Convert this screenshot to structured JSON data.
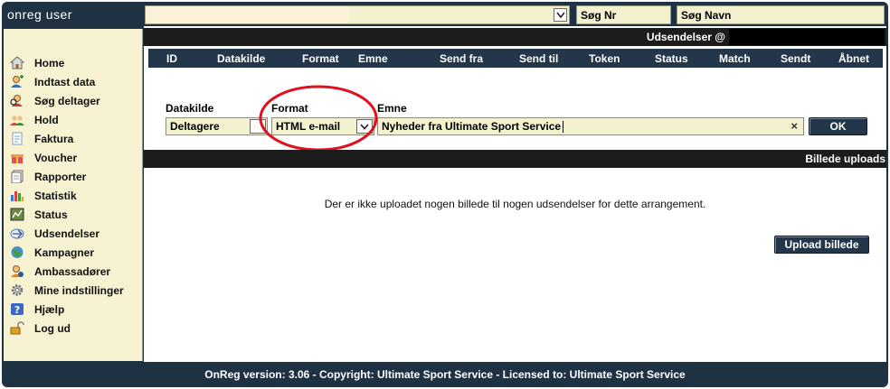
{
  "app": {
    "title": "onreg user"
  },
  "search": {
    "nr_label": "Søg Nr",
    "navn_label": "Søg Navn"
  },
  "nav": {
    "items": [
      {
        "label": "Home",
        "icon": "house-icon"
      },
      {
        "label": "Indtast data",
        "icon": "person-add-icon"
      },
      {
        "label": "Søg deltager",
        "icon": "magnifier-icon"
      },
      {
        "label": "Hold",
        "icon": "group-icon"
      },
      {
        "label": "Faktura",
        "icon": "invoice-icon"
      },
      {
        "label": "Voucher",
        "icon": "gift-icon"
      },
      {
        "label": "Rapporter",
        "icon": "report-icon"
      },
      {
        "label": "Statistik",
        "icon": "bar-chart-icon"
      },
      {
        "label": "Status",
        "icon": "status-icon"
      },
      {
        "label": "Udsendelser",
        "icon": "mail-send-icon"
      },
      {
        "label": "Kampagner",
        "icon": "globe-icon"
      },
      {
        "label": "Ambassadører",
        "icon": "ambassador-icon"
      },
      {
        "label": "Mine indstillinger",
        "icon": "gear-icon"
      },
      {
        "label": "Hjælp",
        "icon": "help-icon"
      },
      {
        "label": "Log ud",
        "icon": "padlock-open-icon"
      }
    ]
  },
  "udsendelser": {
    "title": "Udsendelser @",
    "columns": [
      "ID",
      "Datakilde",
      "Format",
      "Emne",
      "Send fra",
      "Send til",
      "Token",
      "Status",
      "Match",
      "Sendt",
      "Åbnet"
    ]
  },
  "form": {
    "datakilde_label": "Datakilde",
    "datakilde_value": "Deltagere",
    "format_label": "Format",
    "format_value": "HTML e-mail",
    "emne_label": "Emne",
    "emne_value": "Nyheder fra Ultimate Sport Service",
    "clear_glyph": "×",
    "ok_label": "OK"
  },
  "billede": {
    "title": "Billede uploads",
    "empty_message": "Der er ikke uploadet nogen billede til nogen udsendelser for dette arrangement.",
    "upload_label": "Upload billede"
  },
  "footer": {
    "text": "OnReg version: 3.06 - Copyright: Ultimate Sport Service - Licensed to: Ultimate Sport Service"
  },
  "colors": {
    "frame": "#1f3244",
    "sidebar": "#f6f2d2",
    "field": "#f4f1cf",
    "header": "#23364a",
    "highlight": "#e0101e"
  }
}
